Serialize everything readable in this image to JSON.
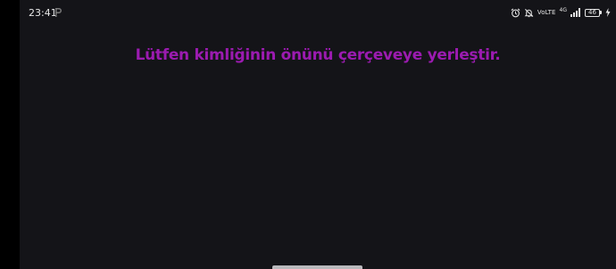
{
  "status_bar": {
    "time": "23:41",
    "volte": "VoLTE",
    "network": "4G",
    "battery": "46",
    "icons": [
      "p-icon",
      "alarm-icon",
      "mute-icon",
      "signal-icon",
      "battery-icon",
      "charging-icon"
    ]
  },
  "main": {
    "instruction": "Lütfen kimliğinin önünü çerçeveye yerleştir."
  },
  "colors": {
    "background": "#141418",
    "accent": "#9b1bb0",
    "status_text": "#e6e6e6"
  }
}
